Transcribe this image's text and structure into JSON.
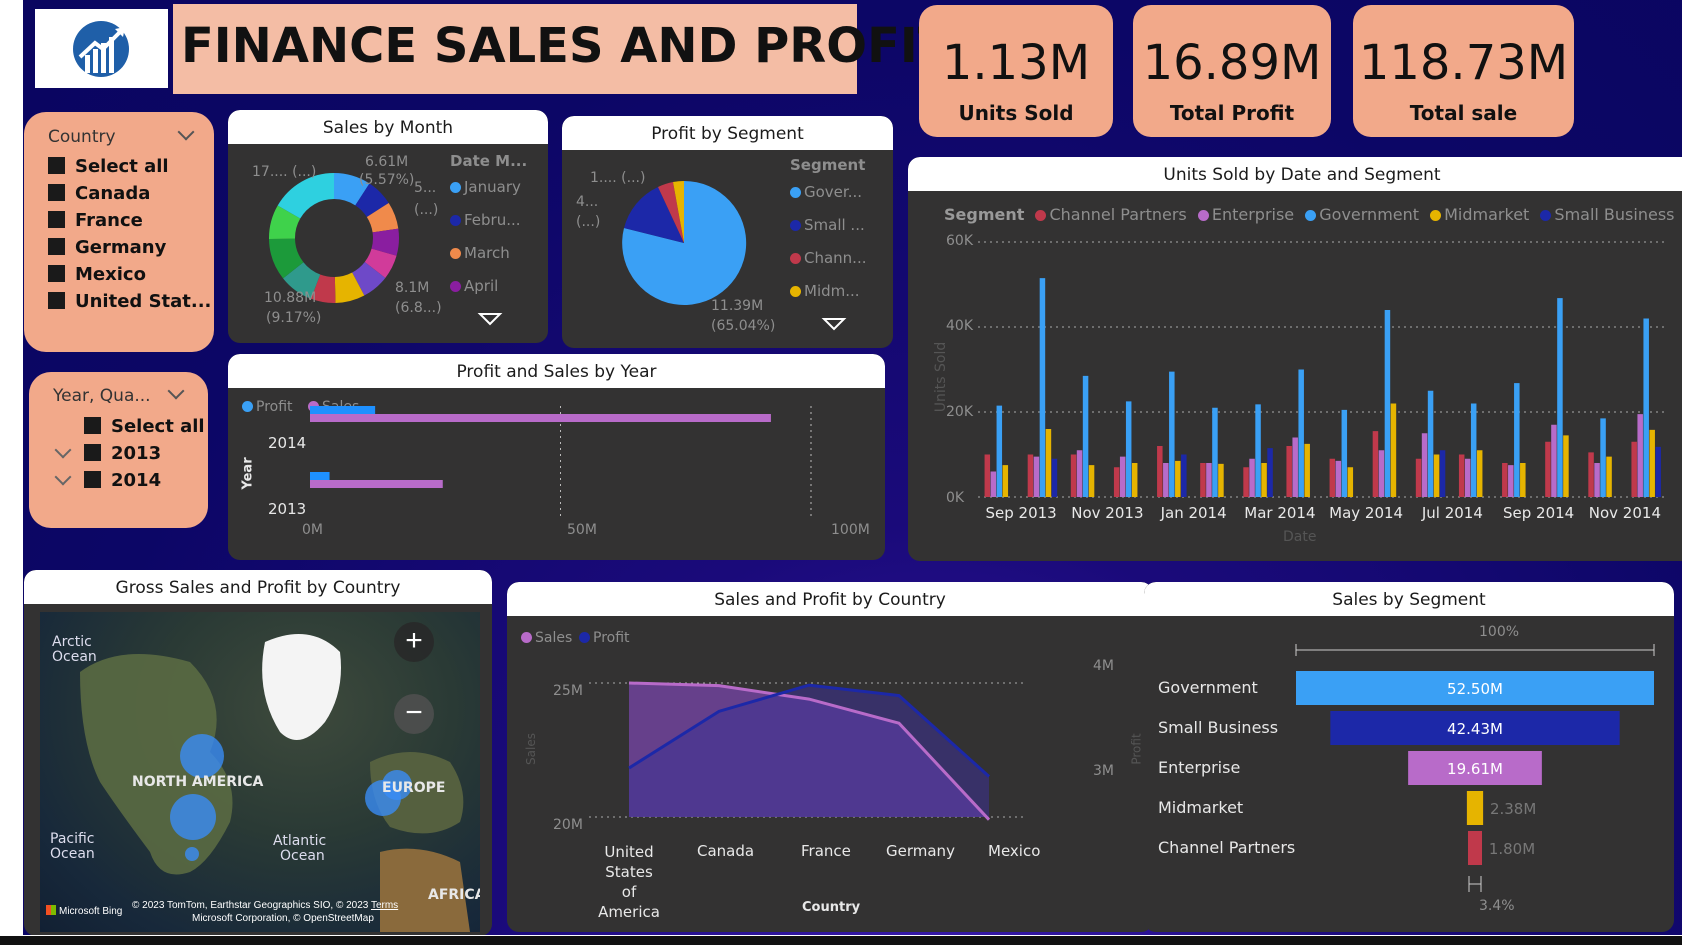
{
  "header": {
    "title": "FINANCE SALES AND PROFIT",
    "logo_icon": "chart-growth-logo-icon"
  },
  "kpis": [
    {
      "value": "1.13M",
      "label": "Units Sold"
    },
    {
      "value": "16.89M",
      "label": "Total Profit"
    },
    {
      "value": "118.73M",
      "label": "Total sale"
    }
  ],
  "country_slicer": {
    "title": "Country",
    "items": [
      "Select all",
      "Canada",
      "France",
      "Germany",
      "Mexico",
      "United Stat..."
    ]
  },
  "year_slicer": {
    "title": "Year, Qua...",
    "items": [
      "Select all",
      "2013",
      "2014"
    ]
  },
  "sales_by_month": {
    "title": "Sales by Month",
    "legend_title": "Date M...",
    "legend": [
      "January",
      "Febru...",
      "March",
      "April"
    ],
    "labels": [
      "17.... (...)",
      "6.61M",
      "(5.57%)",
      "5...",
      "(...)",
      "10.88M",
      "(9.17%)",
      "8.1M",
      "(6.8...)"
    ]
  },
  "profit_by_segment": {
    "title": "Profit by Segment",
    "legend_title": "Segment",
    "legend": [
      "Gover...",
      "Small ...",
      "Chann...",
      "Midm..."
    ],
    "labels": [
      "1.... (...)",
      "4...",
      "(...)",
      "11.39M",
      "(65.04%)"
    ]
  },
  "profit_sales_by_year": {
    "title": "Profit and Sales by Year",
    "legend": [
      "Profit",
      "Sales"
    ],
    "y_title": "Year",
    "x_ticks": [
      "0M",
      "50M",
      "100M"
    ]
  },
  "units_by_date": {
    "title": "Units Sold by Date and Segment",
    "legend_title": "Segment",
    "y_title": "Units Sold",
    "x_title": "Date",
    "y_ticks": [
      "0K",
      "20K",
      "40K",
      "60K"
    ],
    "x_ticks": [
      "Sep 2013",
      "Nov 2013",
      "Jan 2014",
      "Mar 2014",
      "May 2014",
      "Jul 2014",
      "Sep 2014",
      "Nov 2014"
    ]
  },
  "map": {
    "title": "Gross Sales and Profit by Country",
    "labels": [
      "Arctic",
      "Ocean",
      "NORTH AMERICA",
      "EUROPE",
      "Pacific",
      "Ocean",
      "Atlantic",
      "Ocean",
      "AFRICA"
    ],
    "attribution": "© 2023 TomTom, Earthstar Geographics SIO, © 2023",
    "attribution2": "Microsoft Corporation, © OpenStreetMap",
    "terms": "Terms",
    "bing": "Microsoft Bing"
  },
  "sales_profit_country": {
    "title": "Sales and Profit by Country",
    "legend": [
      "Sales",
      "Profit"
    ],
    "y_left_ticks": [
      "20M",
      "25M"
    ],
    "y_right_ticks": [
      "3M",
      "4M"
    ],
    "y_left_title": "Sales",
    "y_right_title": "Profit",
    "x_title": "Country",
    "x_labels": [
      "United States of America",
      "Canada",
      "France",
      "Germany",
      "Mexico"
    ]
  },
  "sales_by_segment": {
    "title": "Sales by Segment",
    "top_label": "100%",
    "bottom_label": "3.4%"
  },
  "colors": {
    "government": "#3aa0f5",
    "small_business": "#1c28a8",
    "channel_partners": "#c0394b",
    "midmarket": "#e6b400",
    "enterprise": "#b86bc9",
    "sales": "#b86bc9",
    "profit": "#1c28a8",
    "kpi_bg": "#f2a98a"
  },
  "chart_data": [
    {
      "type": "bar",
      "title": "Profit and Sales by Year",
      "orientation": "horizontal",
      "categories": [
        "2014",
        "2013"
      ],
      "series": [
        {
          "name": "Profit",
          "values": [
            13,
            3.9
          ]
        },
        {
          "name": "Sales",
          "values": [
            92,
            26.5
          ]
        }
      ],
      "xlim": [
        0,
        100
      ],
      "xlabel": "",
      "ylabel": "Year"
    },
    {
      "type": "bar",
      "title": "Units Sold by Date and Segment",
      "categories": [
        "Sep 2013",
        "Oct 2013",
        "Nov 2013",
        "Dec 2013",
        "Jan 2014",
        "Feb 2014",
        "Mar 2014",
        "Apr 2014",
        "May 2014",
        "Jun 2014",
        "Jul 2014",
        "Aug 2014",
        "Sep 2014",
        "Oct 2014",
        "Nov 2014",
        "Dec 2014"
      ],
      "series": [
        {
          "name": "Channel Partners",
          "values": [
            10000,
            10000,
            10000,
            7000,
            12000,
            8000,
            7000,
            12000,
            9000,
            15500,
            9000,
            10000,
            8000,
            13000,
            10500,
            13000
          ]
        },
        {
          "name": "Enterprise",
          "values": [
            6000,
            9500,
            11000,
            9500,
            8000,
            8000,
            9000,
            14000,
            8500,
            11000,
            15000,
            9000,
            7500,
            17000,
            8000,
            19500
          ]
        },
        {
          "name": "Government",
          "values": [
            21500,
            51500,
            28500,
            22500,
            29500,
            21000,
            21800,
            30000,
            20500,
            44000,
            25000,
            22000,
            26800,
            46800,
            18500,
            42000
          ]
        },
        {
          "name": "Midmarket",
          "values": [
            7500,
            16000,
            7500,
            8000,
            8500,
            7800,
            8000,
            12500,
            7000,
            22000,
            10000,
            11000,
            8000,
            14500,
            9500,
            15800
          ]
        },
        {
          "name": "Small Business",
          "values": [
            0,
            9000,
            0,
            0,
            10000,
            0,
            11500,
            0,
            0,
            0,
            11000,
            0,
            0,
            0,
            0,
            11800
          ]
        }
      ],
      "ylim": [
        0,
        60000
      ],
      "xlabel": "Date",
      "ylabel": "Units Sold"
    },
    {
      "type": "line",
      "title": "Sales and Profit by Country",
      "categories": [
        "United States of America",
        "Canada",
        "France",
        "Germany",
        "Mexico"
      ],
      "series": [
        {
          "name": "Sales",
          "axis": "left",
          "values": [
            25.0,
            24.9,
            24.4,
            23.5,
            19.9
          ]
        },
        {
          "name": "Profit",
          "axis": "right",
          "values": [
            2.99,
            3.53,
            3.78,
            3.68,
            2.91
          ]
        }
      ],
      "ylim_left": [
        20,
        25
      ],
      "ylim_right": [
        2.75,
        4.1
      ],
      "xlabel": "Country",
      "ylabel": "Sales"
    },
    {
      "type": "bar",
      "title": "Sales by Segment",
      "chart_subtype": "funnel",
      "categories": [
        "Government",
        "Small Business",
        "Enterprise",
        "Midmarket",
        "Channel Partners"
      ],
      "values": [
        52.5,
        42.43,
        19.61,
        2.38,
        1.8
      ],
      "value_labels": [
        "52.50M",
        "42.43M",
        "19.61M",
        "2.38M",
        "1.80M"
      ],
      "unit": "M"
    },
    {
      "type": "pie",
      "title": "Sales by Month",
      "donut": true,
      "categories": [
        "January",
        "February",
        "March",
        "April"
      ],
      "values": [
        6.61,
        10.88,
        8.1,
        17.0
      ],
      "percent_labels": [
        "(5.57%)",
        "(9.17%)"
      ]
    },
    {
      "type": "pie",
      "title": "Profit by Segment",
      "categories": [
        "Government",
        "Small Business",
        "Channel Partners",
        "Midmarket"
      ],
      "values": [
        11.39,
        4.1,
        1.3,
        0.66
      ],
      "percent_labels": [
        "(65.04%)"
      ]
    }
  ]
}
